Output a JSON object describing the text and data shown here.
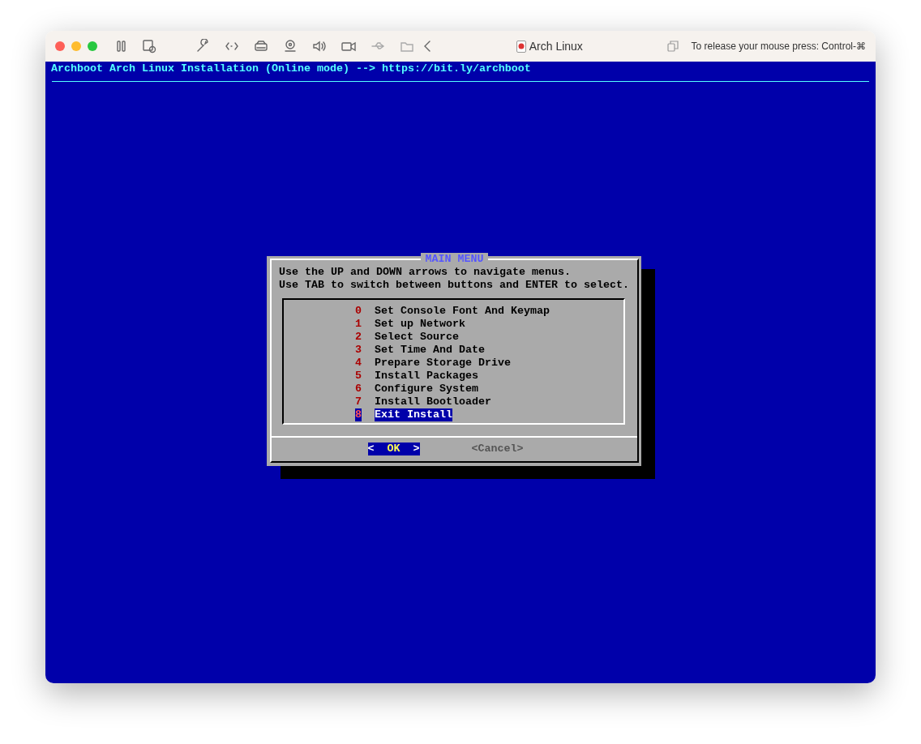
{
  "window": {
    "title": "Arch Linux",
    "mouse_hint": "To release your mouse press: Control-⌘"
  },
  "terminal": {
    "header": "Archboot Arch Linux Installation (Online mode) --> https://bit.ly/archboot"
  },
  "dialog": {
    "title": "MAIN MENU",
    "instructions": [
      "Use the UP and DOWN arrows to navigate menus.",
      "Use TAB to switch between buttons and ENTER to select."
    ],
    "items": [
      {
        "key": "0",
        "label": "Set Console Font And Keymap",
        "selected": false
      },
      {
        "key": "1",
        "label": "Set up Network",
        "selected": false
      },
      {
        "key": "2",
        "label": "Select Source",
        "selected": false
      },
      {
        "key": "3",
        "label": "Set Time And Date",
        "selected": false
      },
      {
        "key": "4",
        "label": "Prepare Storage Drive",
        "selected": false
      },
      {
        "key": "5",
        "label": "Install Packages",
        "selected": false
      },
      {
        "key": "6",
        "label": "Configure System",
        "selected": false
      },
      {
        "key": "7",
        "label": "Install Bootloader",
        "selected": false
      },
      {
        "key": "8",
        "label": "Exit Install",
        "selected": true
      }
    ],
    "buttons": [
      {
        "open": "<",
        "label": "OK",
        "close": ">",
        "selected": true
      },
      {
        "open": "<",
        "label": "Cancel",
        "close": ">",
        "selected": false
      }
    ]
  }
}
